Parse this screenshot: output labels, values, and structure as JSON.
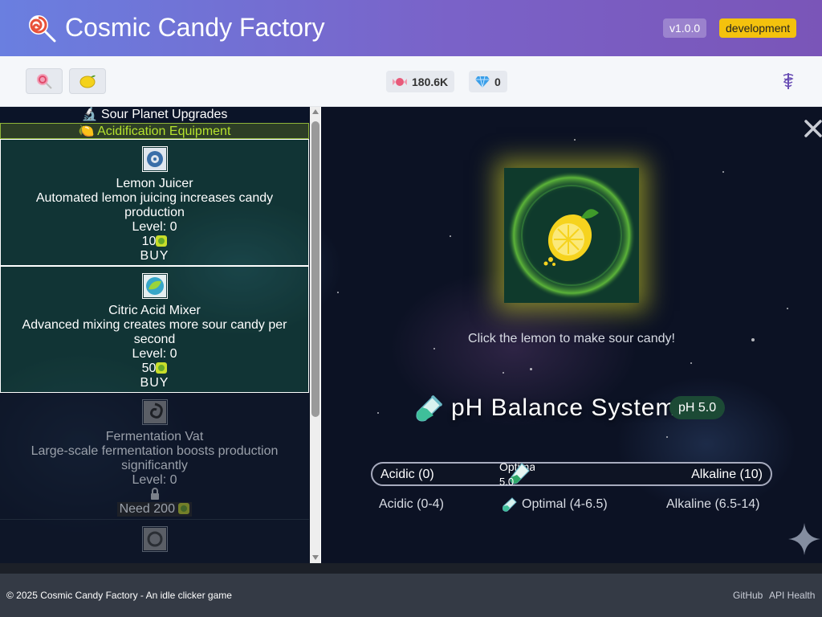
{
  "header": {
    "title": "Cosmic Candy Factory",
    "version": "v1.0.0",
    "environment": "development",
    "logo_icon": "lollipop-icon"
  },
  "toolbar": {
    "planets": [
      {
        "icon": "lollipop-icon",
        "name": "candy-planet"
      },
      {
        "icon": "lemon-icon",
        "name": "sour-planet"
      }
    ],
    "resources": {
      "candy": {
        "icon": "candy-icon",
        "value": "180.6K"
      },
      "gems": {
        "icon": "gem-icon",
        "value": "0"
      }
    },
    "settings_icon": "caduceus-icon"
  },
  "upgrades": {
    "panel_title": "🔬 Sour Planet Upgrades",
    "category": "🍋 Acidification Equipment",
    "items": [
      {
        "name": "Lemon Juicer",
        "description": "Automated lemon juicing increases candy production",
        "level": "Level: 0",
        "cost": "10",
        "action": "BUY",
        "state": "available",
        "icon": "gear-icon"
      },
      {
        "name": "Citric Acid Mixer",
        "description": "Advanced mixing creates more sour candy per second",
        "level": "Level: 0",
        "cost": "50",
        "action": "BUY",
        "state": "available",
        "icon": "leaf-orb-icon"
      },
      {
        "name": "Fermentation Vat",
        "description": "Large-scale fermentation boosts production significantly",
        "level": "Level: 0",
        "cost_label": "Need 200",
        "state": "locked",
        "icon": "vortex-icon"
      },
      {
        "state": "locked",
        "icon": "machine-icon"
      }
    ]
  },
  "game": {
    "click_hint": "Click the lemon to make sour candy!",
    "ph_title": "pH Balance System",
    "ph_badge": "pH 5.0",
    "ph_bar": {
      "left_label": "Acidic (0)",
      "right_label": "Alkaline (10)",
      "marker_label": "Optimal",
      "marker_value": "5.0",
      "level": 5.0,
      "min": 0,
      "max": 10
    },
    "zones": [
      {
        "label": "Acidic (0-4)"
      },
      {
        "label": "Optimal (4-6.5)",
        "icon": "test-tube-icon"
      },
      {
        "label": "Alkaline (6.5-14)"
      }
    ]
  },
  "footer": {
    "copyright": "© 2025 Cosmic Candy Factory - An idle clicker game",
    "links": [
      "GitHub",
      "API Health"
    ]
  },
  "colors": {
    "header_start": "#6a7fe0",
    "header_end": "#7a55b8",
    "env_badge": "#f4c20d",
    "category_text": "#b5e22e",
    "ph_badge_bg": "#1c4a35",
    "footer_bg": "#343a45"
  }
}
